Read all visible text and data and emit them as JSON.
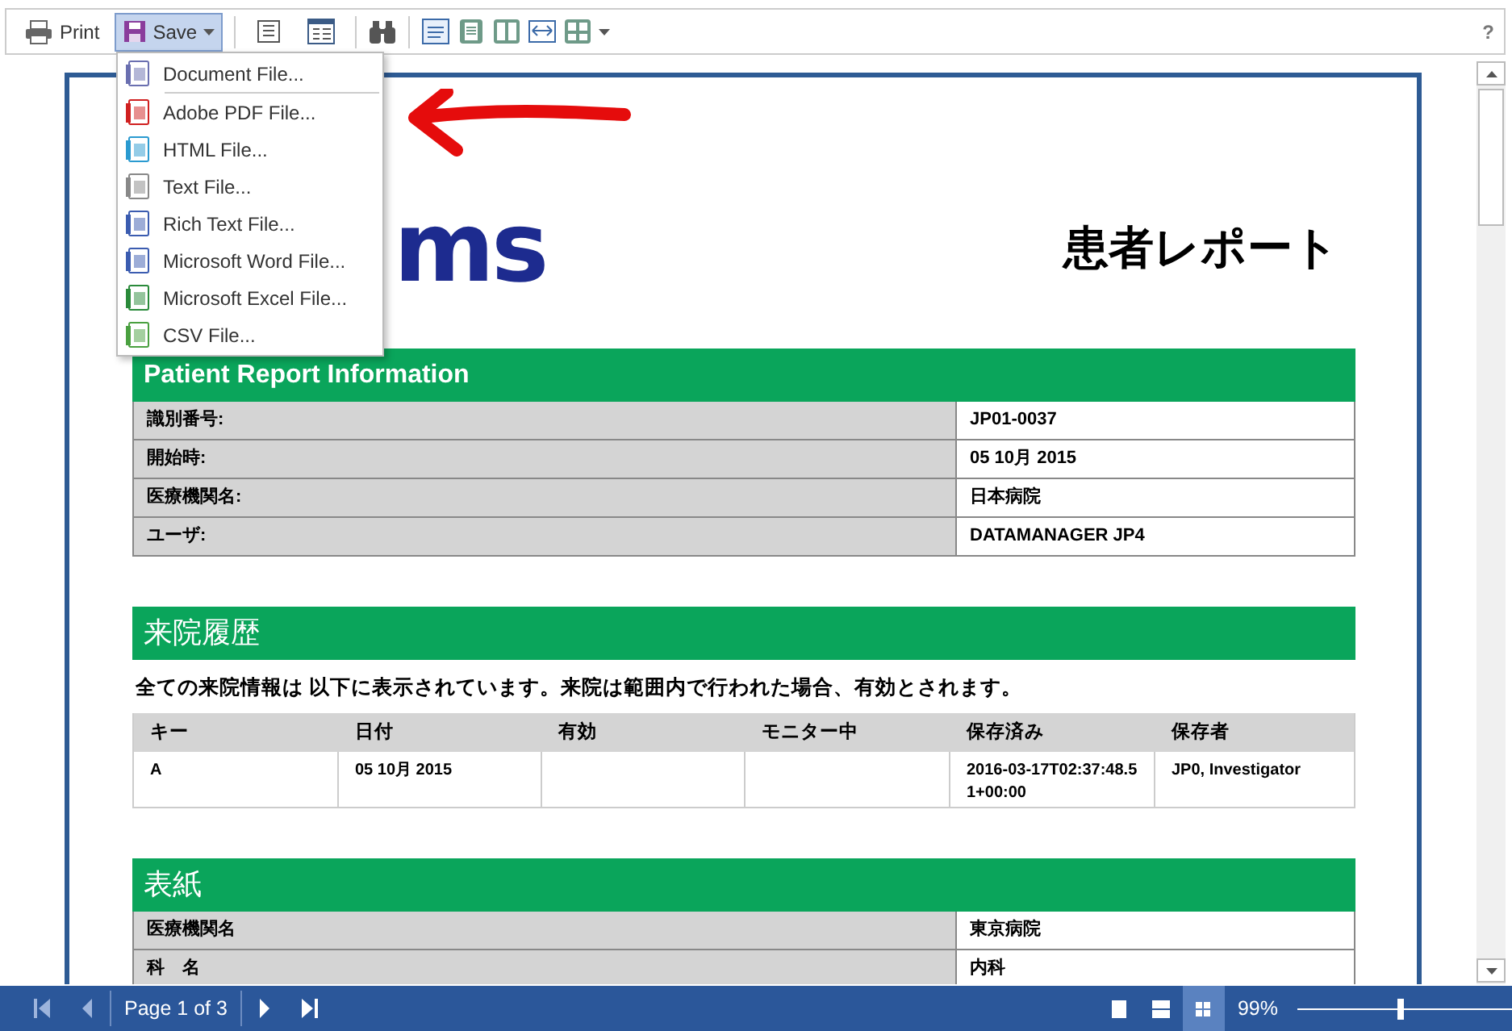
{
  "toolbar": {
    "print": "Print",
    "save": "Save",
    "save_open": true,
    "help": "?"
  },
  "save_menu": [
    {
      "label": "Document File...",
      "kind": "doc"
    },
    {
      "label": "Adobe PDF File...",
      "kind": "pdf"
    },
    {
      "label": "HTML File...",
      "kind": "html"
    },
    {
      "label": "Text File...",
      "kind": "txt"
    },
    {
      "label": "Rich Text File...",
      "kind": "rtf"
    },
    {
      "label": "Microsoft Word File...",
      "kind": "word"
    },
    {
      "label": "Microsoft Excel File...",
      "kind": "excel"
    },
    {
      "label": "CSV File...",
      "kind": "csv"
    }
  ],
  "report": {
    "logo": "ms",
    "title": "患者レポート",
    "info": {
      "title": "Patient Report Information",
      "rows": [
        {
          "label": "識別番号:",
          "value": "JP01-0037"
        },
        {
          "label": "開始時:",
          "value": "05 10月 2015"
        },
        {
          "label": "医療機関名:",
          "value": "日本病院"
        },
        {
          "label": "ユーザ:",
          "value": "DATAMANAGER JP4"
        }
      ]
    },
    "visits": {
      "title": "来院履歴",
      "note": "全ての来院情報は 以下に表示されています。来院は範囲内で行われた場合、有効とされます。",
      "columns": [
        "キー",
        "日付",
        "有効",
        "モニター中",
        "保存済み",
        "保存者"
      ],
      "rows": [
        [
          "A",
          "05 10月 2015",
          "",
          "",
          "2016-03-17T02:37:48.51+00:00",
          "JP0, Investigator"
        ]
      ]
    },
    "cover": {
      "title": "表紙",
      "rows": [
        {
          "label": "医療機関名",
          "value": "東京病院"
        },
        {
          "label": "科　名",
          "value": "内科"
        }
      ]
    }
  },
  "footer": {
    "page": "Page 1 of 3",
    "view_modes": [
      {
        "selected": false
      },
      {
        "selected": false
      },
      {
        "selected": true
      }
    ],
    "zoom": "99%",
    "level": 0.48
  }
}
